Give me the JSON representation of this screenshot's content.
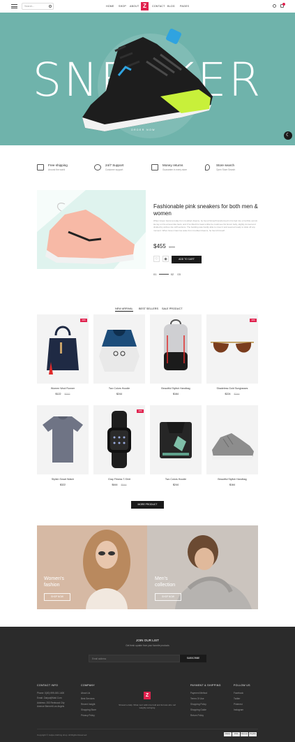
{
  "header": {
    "search_placeholder": "Search...",
    "nav": [
      "HOME",
      "SHOP",
      "ABOUT",
      "CONTACT",
      "BLOG",
      "PAGES"
    ],
    "logo": "Z"
  },
  "hero": {
    "word": "SNEAKER",
    "sub": "ORDER NOW"
  },
  "features": [
    {
      "title": "Free shipping",
      "sub": "Around the world",
      "icon": "truck-icon"
    },
    {
      "title": "24/7 Support",
      "sub": "Customer support",
      "icon": "alarm-icon"
    },
    {
      "title": "Money returns",
      "sub": "Guarantee in every store",
      "icon": "wallet-icon"
    },
    {
      "title": "Store search",
      "sub": "Open Store Search",
      "icon": "location-icon"
    }
  ],
  "featured": {
    "title": "Fashionable pink sneakers for both men & women",
    "desc": "When Green Gamma today from troubled dreams, he found himself transformed in his bed into a horrible vermin. He lay on his armour-like back, and if he lifted his head a little he could see his brown belly, slightly domed and divided by arches into stiff sections. The bedding was hardly able to cover it and seemed ready to slide off any moment. When Green Gamma woke from troubled dreams, he found himself.",
    "price": "$455",
    "old_price": "$555",
    "add_to_cart": "ADD TO CART",
    "pager_current": "01",
    "pager_next": "02",
    "pager_last": "03"
  },
  "tabs": [
    "NEW ARRIVAL",
    "BEST SELLERS",
    "SALE PRODUCT"
  ],
  "products": [
    {
      "name": "Women Wool Runner",
      "price": "$122",
      "old": "$332",
      "badge": "10%"
    },
    {
      "name": "Two Colors Hoodie",
      "price": "$244",
      "old": "",
      "badge": ""
    },
    {
      "name": "Beautiful Stylish Handbag",
      "price": "$164",
      "old": "",
      "badge": ""
    },
    {
      "name": "Shadeless Gold Sunglasses",
      "price": "$224",
      "old": "$244",
      "badge": "10%"
    },
    {
      "name": "Stylish Smart Watch",
      "price": "$322",
      "old": "",
      "badge": ""
    },
    {
      "name": "Gray Fitness T-Shirt",
      "price": "$444",
      "old": "$544",
      "badge": "10%"
    },
    {
      "name": "Two Colors Hoodie",
      "price": "$244",
      "old": "",
      "badge": ""
    },
    {
      "name": "Beautiful Stylish Handbag",
      "price": "$164",
      "old": "",
      "badge": ""
    }
  ],
  "more_button": "MORE PRODUCT",
  "banners": {
    "women_title_1": "Women's",
    "women_title_2": "fashion",
    "men_title_1": "Men's",
    "men_title_2": "collection",
    "button": "SHOP NOW"
  },
  "footer": {
    "newsletter_title": "JOIN OUR LIST",
    "newsletter_sub": "Get fresh update from your favorite products",
    "email_placeholder": "Email address",
    "subscribe": "SUBSCRIBE",
    "contact_title": "CONTACT INFO",
    "contact_lines": [
      "Phone: 0(00) 999-000-1400",
      "Email: Zaripa@Mail.Com",
      "Address: 253 Redwood City",
      "Avenue Bennett Los Angels"
    ],
    "company_title": "COMPANY",
    "company_links": [
      "About Us",
      "Best Services",
      "Recent Insight",
      "Shopping Store",
      "Privacy Policy"
    ],
    "about_text": "Shrewd a daily. What mort within bel told and furrows who reif weighty swinging",
    "payment_title": "PAYMENT & SHIPPING",
    "payment_links": [
      "Payment Method",
      "Terms Of Use",
      "Shopping Policy",
      "Shopping Guide",
      "Return Policy"
    ],
    "follow_title": "FOLLOW US",
    "follow_links": [
      "Facebook",
      "Twitter",
      "Pinterest",
      "Instagram"
    ],
    "copyright": "Copyright © zaripa clothing shop. All Rights Reserved",
    "payments": [
      "Master",
      "VISA",
      "Discover",
      "PayPal"
    ]
  }
}
